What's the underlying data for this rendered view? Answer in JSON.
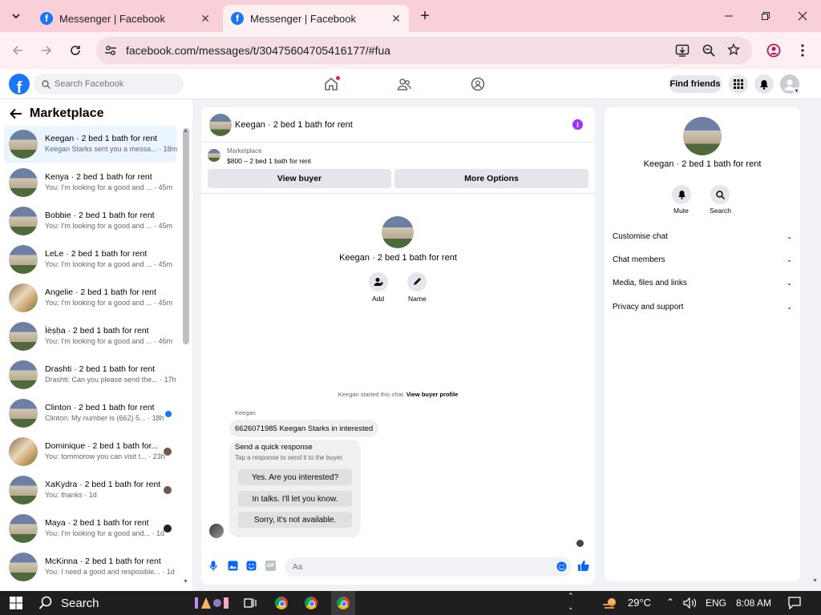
{
  "browser": {
    "tabs": [
      {
        "title": "Messenger | Facebook"
      },
      {
        "title": "Messenger | Facebook"
      }
    ],
    "url": "facebook.com/messages/t/30475604705416177/#fua"
  },
  "fb_header": {
    "search_placeholder": "Search Facebook",
    "find_friends": "Find friends"
  },
  "sidebar": {
    "title": "Marketplace",
    "conversations": [
      {
        "name": "Keegan · 2 bed 1 bath for rent",
        "preview": "Keegan Starks sent you a messa...",
        "time": "18m"
      },
      {
        "name": "Kenya · 2 bed 1 bath for rent",
        "preview": "You: I'm looking for a good and ...",
        "time": "45m"
      },
      {
        "name": "Bobbie · 2 bed 1 bath for rent",
        "preview": "You: I'm looking for a good and ...",
        "time": "45m"
      },
      {
        "name": "LeLe · 2 bed 1 bath for rent",
        "preview": "You: I'm looking for a good and ...",
        "time": "45m"
      },
      {
        "name": "Angelie · 2 bed 1 bath for rent",
        "preview": "You: I'm looking for a good and ...",
        "time": "45m"
      },
      {
        "name": "Ìèṣḥa · 2 bed 1 bath for rent",
        "preview": "You: I'm looking for a good and ...",
        "time": "46m"
      },
      {
        "name": "Drashti · 2 bed 1 bath for rent",
        "preview": "Drashti: Can you please send the...",
        "time": "17h"
      },
      {
        "name": "Clinton · 2 bed 1 bath for rent",
        "preview": "Clinton: My number is (662) 5...",
        "time": "18h"
      },
      {
        "name": "Dominique · 2 bed 1 bath for...",
        "preview": "You: tommorow you can visit t...",
        "time": "23h"
      },
      {
        "name": "XaKydra · 2 bed 1 bath for rent",
        "preview": "You: thanks",
        "time": "1d"
      },
      {
        "name": "Maya · 2 bed 1 bath for rent",
        "preview": "You: I'm looking for a good and...",
        "time": "1d"
      },
      {
        "name": "McKinna · 2 bed 1 bath for rent",
        "preview": "You: I need a good and resposible...",
        "time": "1d"
      }
    ]
  },
  "chat": {
    "title": "Keegan · 2 bed 1 bath for rent",
    "marketplace_label": "Marketplace",
    "listing": "$800 – 2 bed 1 bath for rent",
    "view_buyer": "View buyer",
    "more_options": "More Options",
    "profile_name": "Keegan · 2 bed 1 bath for rent",
    "add_label": "Add",
    "name_label": "Name",
    "started_text": "Keegan started this chat.",
    "view_buyer_profile": "View buyer profile",
    "sender": "Keegan",
    "message": "6626071985 Keegan Starks in interested",
    "quick_title": "Send a quick response",
    "quick_sub": "Tap a response to send it to the buyer.",
    "quick_responses": [
      "Yes. Are you interested?",
      "In talks. I'll let you know.",
      "Sorry, it's not available."
    ],
    "composer_placeholder": "Aa"
  },
  "info": {
    "name": "Keegan · 2 bed 1 bath for rent",
    "mute": "Mute",
    "search": "Search",
    "items": [
      "Customise chat",
      "Chat members",
      "Media, files and links",
      "Privacy and support"
    ]
  },
  "taskbar": {
    "search": "Search",
    "temp": "29°C",
    "lang": "ENG",
    "time": "8:08 AM"
  }
}
